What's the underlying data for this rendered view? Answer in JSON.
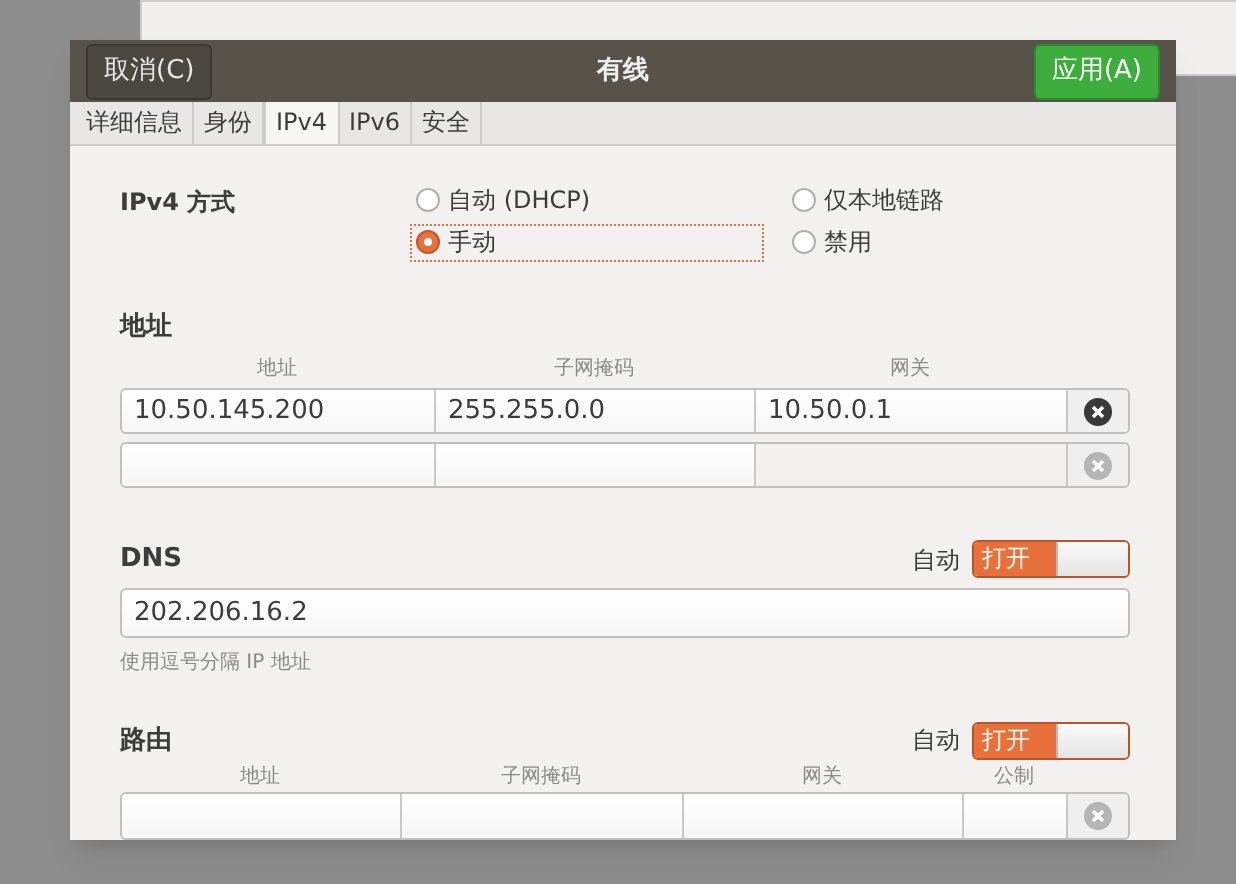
{
  "window": {
    "title": "有线",
    "cancel_button": "取消(C)",
    "apply_button": "应用(A)"
  },
  "tabs": [
    {
      "label": "详细信息",
      "selected": false
    },
    {
      "label": "身份",
      "selected": false
    },
    {
      "label": "IPv4",
      "selected": true
    },
    {
      "label": "IPv6",
      "selected": false
    },
    {
      "label": "安全",
      "selected": false
    }
  ],
  "ipv4_method": {
    "label": "IPv4 方式",
    "options": [
      {
        "label": "自动 (DHCP)",
        "selected": false
      },
      {
        "label": "仅本地链路",
        "selected": false
      },
      {
        "label": "手动",
        "selected": true
      },
      {
        "label": "禁用",
        "selected": false
      }
    ]
  },
  "addresses": {
    "title": "地址",
    "columns": [
      "地址",
      "子网掩码",
      "网关"
    ],
    "rows": [
      {
        "values": [
          "10.50.145.200",
          "255.255.0.0",
          "10.50.0.1"
        ],
        "disabled": false
      },
      {
        "disabled": true
      }
    ]
  },
  "dns": {
    "title": "DNS",
    "auto_label": "自动",
    "switch": {
      "label": "打开",
      "on": true
    },
    "value": "202.206.16.2",
    "hint": "使用逗号分隔 IP 地址"
  },
  "routes": {
    "title": "路由",
    "auto_label": "自动",
    "switch": {
      "label": "打开",
      "on": true
    },
    "columns": [
      "地址",
      "子网掩码",
      "网关",
      "公制"
    ],
    "rows": [
      {
        "disabled": true
      }
    ]
  }
}
